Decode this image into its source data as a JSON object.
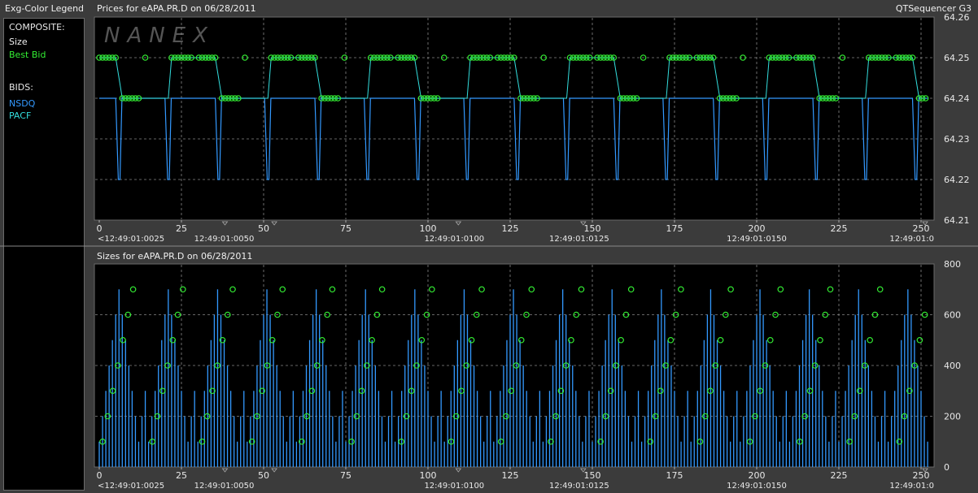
{
  "legend": {
    "title": "Exg-Color Legend",
    "composite_header": "COMPOSITE:",
    "composite_items": [
      {
        "label": "Size",
        "color": "#f0f0f0"
      },
      {
        "label": "Best Bid",
        "color": "#33ee33"
      }
    ],
    "bids_header": "BIDS:",
    "bid_items": [
      {
        "label": "NSDQ",
        "color": "#3399ff"
      },
      {
        "label": "PACF",
        "color": "#33dddd"
      }
    ]
  },
  "app_title": "QTSequencer G3",
  "watermark": "NANEX",
  "chart_data": [
    {
      "type": "line",
      "title": "Prices for  eAPA.PR.D  on  06/28/2011",
      "xlim": [
        0,
        252
      ],
      "ylim": [
        64.21,
        64.26
      ],
      "x_ticks": [
        0,
        25,
        50,
        75,
        100,
        125,
        150,
        175,
        200,
        225,
        250
      ],
      "y_ticks": [
        "64.21",
        "64.22",
        "64.23",
        "64.24",
        "64.25",
        "64.26"
      ],
      "time_labels": [
        {
          "x": 0,
          "text": "<12:49:01:0025"
        },
        {
          "x": 38,
          "text": "12:49:01:0050"
        },
        {
          "x": 108,
          "text": "12:49:01:0100"
        },
        {
          "x": 146,
          "text": "12:49:01:0125"
        },
        {
          "x": 200,
          "text": "12:49:01:0150"
        },
        {
          "x": 252,
          "text": "12:49:01:0"
        }
      ],
      "grid": true,
      "cycle_period": 30.3,
      "series": [
        {
          "name": "NSDQ",
          "color": "#3399ff",
          "high": 64.24,
          "low": 64.22
        },
        {
          "name": "PACF",
          "color": "#33dddd",
          "high": 64.25,
          "low": 64.24
        },
        {
          "name": "Best Bid",
          "color": "#33ee33",
          "values": [
            64.25,
            64.24
          ]
        }
      ]
    },
    {
      "type": "bar",
      "title": "Sizes for  eAPA.PR.D  on  06/28/2011",
      "xlim": [
        0,
        252
      ],
      "ylim": [
        0,
        800
      ],
      "x_ticks": [
        0,
        25,
        50,
        75,
        100,
        125,
        150,
        175,
        200,
        225,
        250
      ],
      "y_ticks": [
        "0",
        "200",
        "400",
        "600",
        "800"
      ],
      "time_labels": [
        {
          "x": 0,
          "text": "<12:49:01:0025"
        },
        {
          "x": 38,
          "text": "12:49:01:0050"
        },
        {
          "x": 108,
          "text": "12:49:01:0100"
        },
        {
          "x": 146,
          "text": "12:49:01:0125"
        },
        {
          "x": 200,
          "text": "12:49:01:0150"
        },
        {
          "x": 252,
          "text": "12:49:01:0"
        }
      ],
      "grid": true,
      "cycle_period": 15.15,
      "size_pattern": [
        100,
        200,
        300,
        400,
        500,
        600,
        700,
        600,
        500,
        400,
        300,
        200,
        100,
        200,
        300
      ],
      "bar_color": "#3399ff",
      "marker_color": "#33ee33"
    }
  ]
}
